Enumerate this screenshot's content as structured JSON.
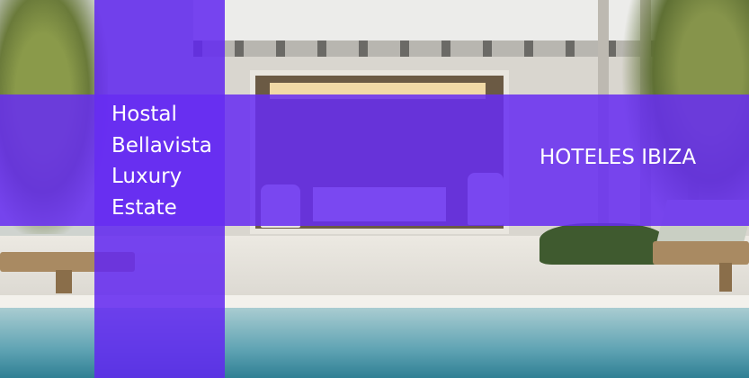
{
  "banner": {
    "hotel_name_lines": [
      "Hostal",
      "Bellavista",
      "Luxury",
      "Estate"
    ],
    "category_label": "HOTELES IBIZA"
  },
  "colors": {
    "overlay": "#6228F0",
    "text": "#FFFFFF"
  }
}
